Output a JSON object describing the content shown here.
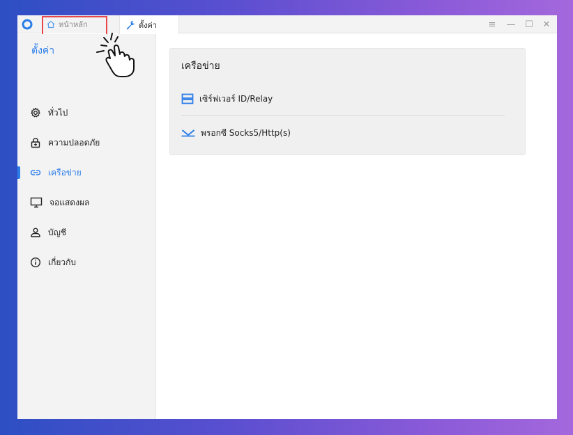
{
  "titlebar": {
    "tabs": [
      {
        "label": "หน้าหลัก",
        "icon": "home-icon"
      },
      {
        "label": "ตั้งค่า",
        "icon": "wrench-icon"
      }
    ],
    "controls": {
      "menu": "≡",
      "minimize": "—",
      "maximize": "☐",
      "close": "✕"
    }
  },
  "sidebar": {
    "title": "ตั้งค่า",
    "items": [
      {
        "label": "ทั่วไป",
        "icon": "gear-icon",
        "active": false
      },
      {
        "label": "ความปลอดภัย",
        "icon": "lock-icon",
        "active": false
      },
      {
        "label": "เครือข่าย",
        "icon": "link-icon",
        "active": true
      },
      {
        "label": "จอแสดงผล",
        "icon": "monitor-icon",
        "active": false
      },
      {
        "label": "บัญชี",
        "icon": "user-icon",
        "active": false
      },
      {
        "label": "เกี่ยวกับ",
        "icon": "info-icon",
        "active": false
      }
    ]
  },
  "main": {
    "card": {
      "title": "เครือข่าย",
      "rows": [
        {
          "label": "เซิร์ฟเวอร์ ID/Relay",
          "icon": "server-icon"
        },
        {
          "label": "พรอกซี Socks5/Http(s)",
          "icon": "proxy-icon"
        }
      ]
    }
  },
  "colors": {
    "accent": "#2b7de9",
    "highlight": "#e8464b",
    "sidebar_bg": "#f3f3f3"
  }
}
